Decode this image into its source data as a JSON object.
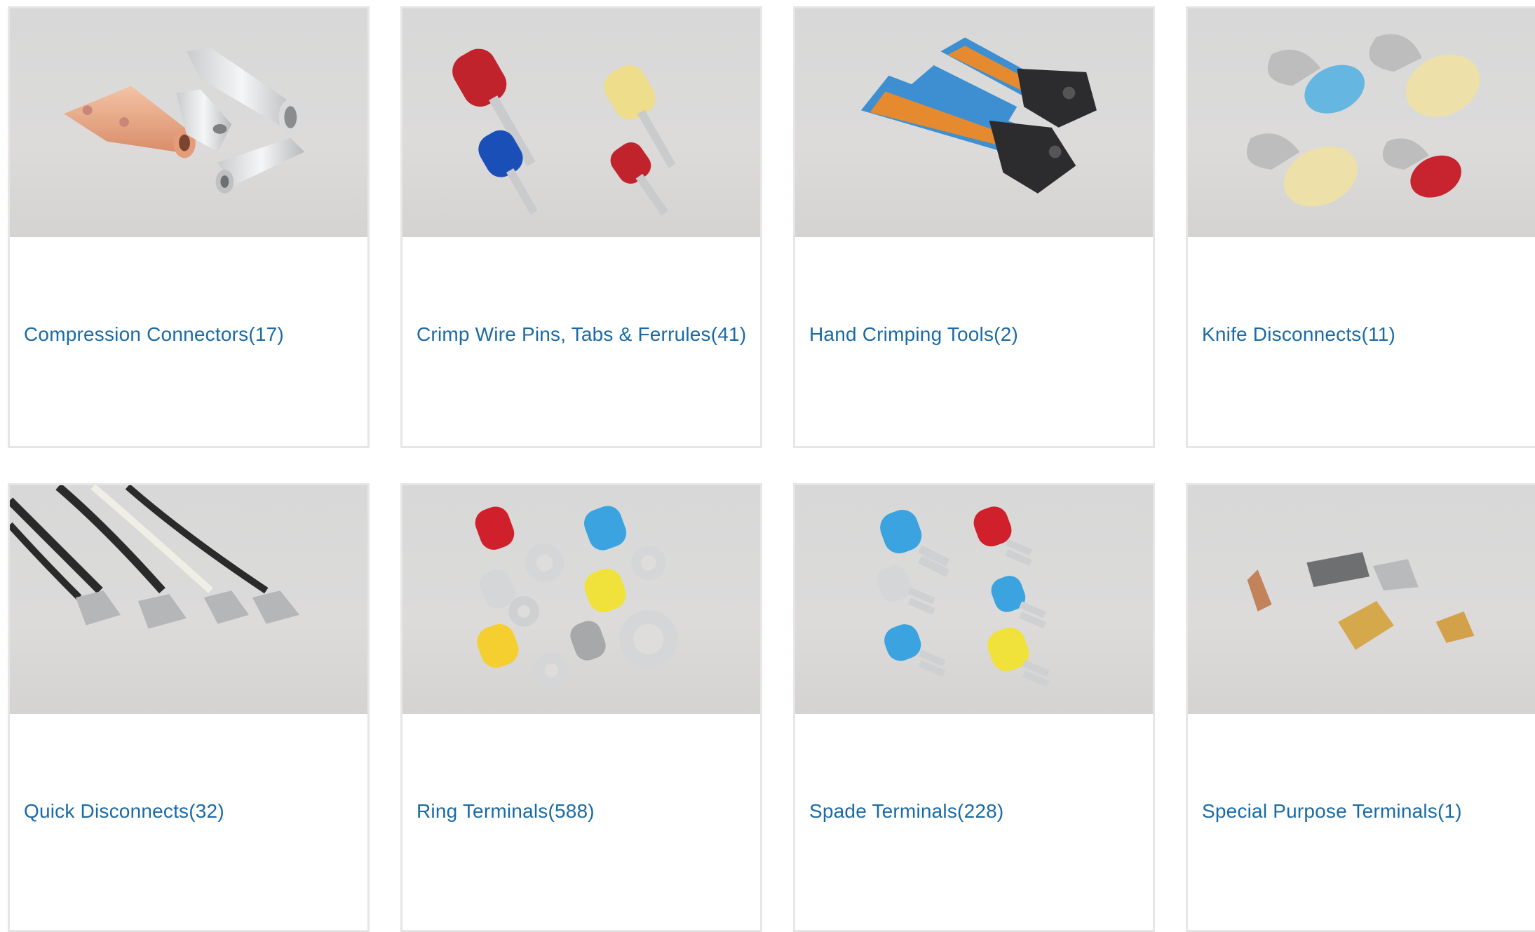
{
  "categories": [
    {
      "label": "Compression Connectors(17)",
      "image": "compression-connectors-image"
    },
    {
      "label": "Crimp Wire Pins, Tabs & Ferrules(41)",
      "image": "crimp-wire-pins-image"
    },
    {
      "label": "Hand Crimping Tools(2)",
      "image": "hand-crimping-tools-image"
    },
    {
      "label": "Knife Disconnects(11)",
      "image": "knife-disconnects-image"
    },
    {
      "label": "Quick Disconnects(32)",
      "image": "quick-disconnects-image"
    },
    {
      "label": "Ring Terminals(588)",
      "image": "ring-terminals-image"
    },
    {
      "label": "Spade Terminals(228)",
      "image": "spade-terminals-image"
    },
    {
      "label": "Special Purpose Terminals(1)",
      "image": "special-purpose-terminals-image"
    }
  ],
  "colors": {
    "link": "#1a6aa6",
    "border": "#e6e6e6",
    "thumb_bg": "#d9d8d7"
  }
}
